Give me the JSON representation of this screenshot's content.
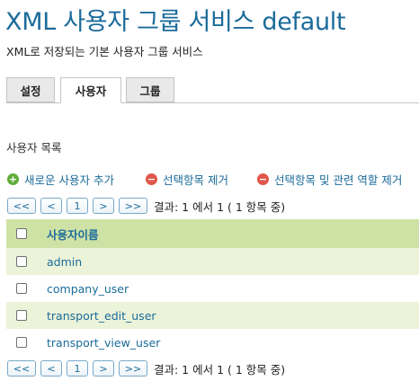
{
  "header": {
    "title": "XML 사용자 그룹 서비스 default",
    "subtitle": "XML로 저장되는 기본 사용자 그룹 서비스"
  },
  "tabs": [
    {
      "label": "설정",
      "active": false
    },
    {
      "label": "사용자",
      "active": true
    },
    {
      "label": "그룹",
      "active": false
    }
  ],
  "section_label": "사용자 목록",
  "actions": {
    "add": "새로운 사용자 추가",
    "remove_selected": "선택항목 제거",
    "remove_selected_roles": "선택항목 및 관련 역할 제거"
  },
  "pager": {
    "first": "<<",
    "prev": "<",
    "page": "1",
    "next": ">",
    "last": ">>",
    "info": "결과: 1 에서 1 ( 1 항목 중)"
  },
  "table": {
    "header": "사용자이름",
    "rows": [
      "admin",
      "company_user",
      "transport_edit_user",
      "transport_view_user"
    ]
  },
  "colors": {
    "accent": "#1b6b9a",
    "header_row": "#cfe2a6",
    "odd_row": "#ebf3d9",
    "add_icon": "#5fae3a",
    "remove_icon": "#e0564b"
  }
}
